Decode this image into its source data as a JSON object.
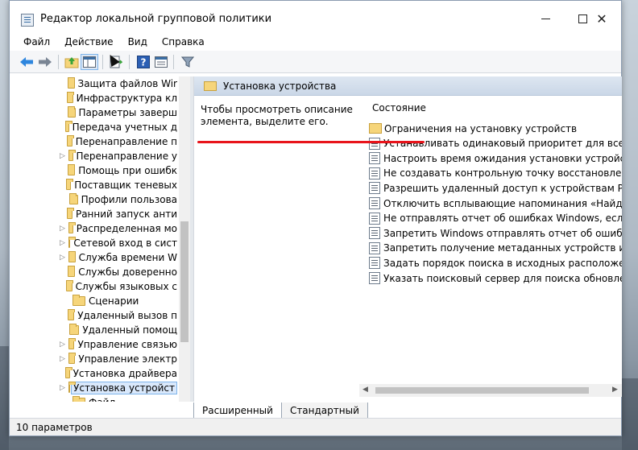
{
  "window": {
    "title": "Редактор локальной групповой политики"
  },
  "menu": [
    "Файл",
    "Действие",
    "Вид",
    "Справка"
  ],
  "toolbar": {
    "icons": [
      "back-arrow-icon",
      "forward-arrow-icon",
      "up-folder-icon",
      "show-hide-tree-icon",
      "export-list-icon",
      "help-icon",
      "properties-icon",
      "filter-icon"
    ]
  },
  "tree": {
    "items": [
      {
        "label": "Защита файлов Wir",
        "expandable": false
      },
      {
        "label": "Инфраструктура кл",
        "expandable": false
      },
      {
        "label": "Параметры заверш",
        "expandable": false
      },
      {
        "label": "Передача учетных д",
        "expandable": false
      },
      {
        "label": "Перенаправление п",
        "expandable": false
      },
      {
        "label": "Перенаправление у",
        "expandable": true
      },
      {
        "label": "Помощь при ошибк",
        "expandable": false
      },
      {
        "label": "Поставщик теневых",
        "expandable": false
      },
      {
        "label": "Профили пользова",
        "expandable": false
      },
      {
        "label": "Ранний запуск анти",
        "expandable": false
      },
      {
        "label": "Распределенная мо",
        "expandable": true
      },
      {
        "label": "Сетевой вход в сист",
        "expandable": true
      },
      {
        "label": "Служба времени W",
        "expandable": true
      },
      {
        "label": "Службы доверенно",
        "expandable": false
      },
      {
        "label": "Службы языковых с",
        "expandable": false
      },
      {
        "label": "Сценарии",
        "expandable": false
      },
      {
        "label": "Удаленный вызов п",
        "expandable": false
      },
      {
        "label": "Удаленный помощ",
        "expandable": false
      },
      {
        "label": "Управление связью",
        "expandable": true
      },
      {
        "label": "Управление электр",
        "expandable": true
      },
      {
        "label": "Установка драйвера",
        "expandable": false
      },
      {
        "label": "Установка устройст",
        "expandable": true,
        "selected": true
      },
      {
        "label": "Файл",
        "expandable": false
      }
    ]
  },
  "right_pane": {
    "header": "Установка устройства",
    "description": "Чтобы просмотреть описание элемента, выделите его.",
    "column_header": "Состояние",
    "rows": [
      {
        "label": "Ограничения на установку устройств",
        "type": "folder"
      },
      {
        "label": "Устанавливать одинаковый приоритет для всех подпис",
        "type": "policy"
      },
      {
        "label": "Настроить время ожидания установки устройства",
        "type": "policy"
      },
      {
        "label": "Не создавать контрольную точку восстановления систе",
        "type": "policy"
      },
      {
        "label": "Разрешить удаленный доступ к устройствам Plug and P",
        "type": "policy"
      },
      {
        "label": "Отключить всплывающие напоминания «Найдено нов",
        "type": "policy"
      },
      {
        "label": "Не отправлять отчет об ошибках Windows, если на устр",
        "type": "policy"
      },
      {
        "label": "Запретить Windows отправлять отчет об ошибках, есл",
        "type": "policy"
      },
      {
        "label": "Запретить получение метаданных устройств из Интерн",
        "type": "policy"
      },
      {
        "label": "Задать порядок поиска в исходных расположениях дра",
        "type": "policy"
      },
      {
        "label": "Указать поисковый сервер для поиска обновлений для",
        "type": "policy"
      }
    ]
  },
  "tabs": [
    "Расширенный",
    "Стандартный"
  ],
  "status": "10 параметров",
  "colors": {
    "highlight_underline": "#e8141b",
    "selection": "#d9e8fb"
  }
}
